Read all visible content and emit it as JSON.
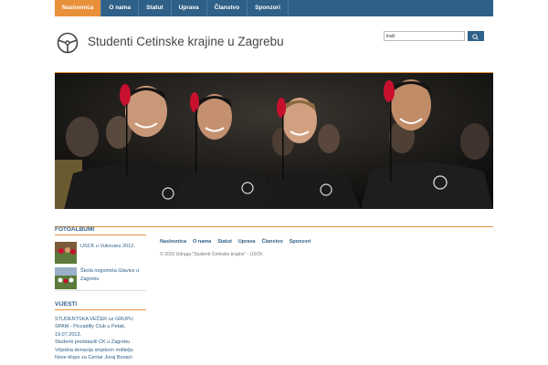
{
  "nav": {
    "items": [
      {
        "label": "Naslovnica",
        "active": true
      },
      {
        "label": "O nama",
        "active": false
      },
      {
        "label": "Statut",
        "active": false
      },
      {
        "label": "Uprava",
        "active": false
      },
      {
        "label": "Članstvo",
        "active": false
      },
      {
        "label": "Sponzori",
        "active": false
      }
    ]
  },
  "header": {
    "site_title": "Studenti Cetinske krajine u Zagrebu",
    "logo_icon": "steering-wheel-icon"
  },
  "search": {
    "value": "traži",
    "button_icon": "search-icon"
  },
  "hero": {
    "description": "four young men in black t-shirts with red fezes"
  },
  "sidebar": {
    "photo_albums": {
      "title": "FOTOALBUMI",
      "items": [
        {
          "label": "USCK u Vukovaru 2012."
        },
        {
          "label": "Škola nogometa Glavice u Zagrebu"
        }
      ]
    },
    "news": {
      "title": "VIJESTI",
      "items": [
        "STUDENTSKA VEČER uz GRUPU SPAM - Piccadilly Club u Petak, 19.07.2013.",
        "Studenti predstavili CK u Zagrebu",
        "Vrijedna donacija sinjskom roditelju",
        "Nove klupe za Centar Juraj Bonaći"
      ]
    }
  },
  "footer": {
    "nav": [
      "Naslovnica",
      "O nama",
      "Statut",
      "Uprava",
      "Članstvo",
      "Sponzori"
    ],
    "copyright": "© 2015 Udruga \"Studenti Cetinske krajine\" - USCK"
  },
  "colors": {
    "primary": "#2f6087",
    "accent": "#e8913a",
    "fez": "#c8102e"
  }
}
